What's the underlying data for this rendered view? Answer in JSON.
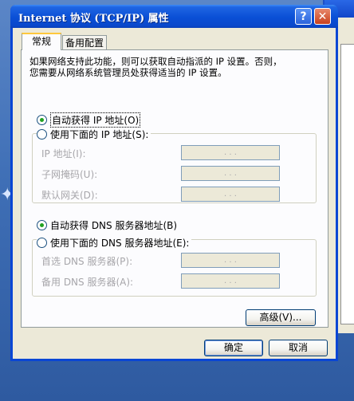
{
  "window": {
    "title": "Internet 协议 (TCP/IP) 属性",
    "help_label": "?",
    "close_label": "✕"
  },
  "tabs": [
    {
      "label": "常规",
      "active": true
    },
    {
      "label": "备用配置",
      "active": false
    }
  ],
  "description": "如果网络支持此功能，则可以获取自动指派的 IP 设置。否则，\n您需要从网络系统管理员处获得适当的 IP 设置。",
  "ip_section": {
    "auto_label": "自动获得 IP 地址(O)",
    "manual_label": "使用下面的 IP 地址(S):",
    "selected": "auto",
    "fields": [
      {
        "label": "IP 地址(I):",
        "value": ". . ."
      },
      {
        "label": "子网掩码(U):",
        "value": ". . ."
      },
      {
        "label": "默认网关(D):",
        "value": ". . ."
      }
    ]
  },
  "dns_section": {
    "auto_label": "自动获得 DNS 服务器地址(B)",
    "manual_label": "使用下面的 DNS 服务器地址(E):",
    "selected": "auto",
    "fields": [
      {
        "label": "首选 DNS 服务器(P):",
        "value": ". . ."
      },
      {
        "label": "备用 DNS 服务器(A):",
        "value": ". . ."
      }
    ]
  },
  "buttons": {
    "advanced": "高级(V)...",
    "ok": "确定",
    "cancel": "取消"
  }
}
